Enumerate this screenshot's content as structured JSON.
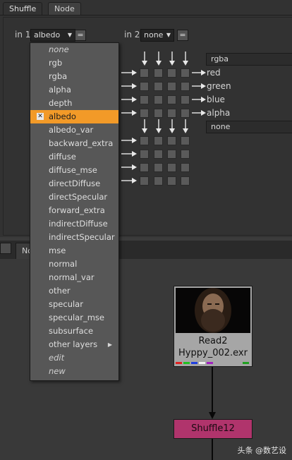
{
  "tabs": {
    "shuffle": "Shuffle",
    "node": "Node"
  },
  "in1": {
    "label": "in 1",
    "value": "albedo",
    "eq": "="
  },
  "in2": {
    "label": "in 2",
    "value": "none",
    "eq": "="
  },
  "right_group1": {
    "layer": "rgba",
    "outputs": [
      "red",
      "green",
      "blue",
      "alpha"
    ]
  },
  "right_group2": {
    "layer": "none"
  },
  "menu": {
    "items": [
      {
        "label": "none",
        "italic": true
      },
      {
        "label": "rgb"
      },
      {
        "label": "rgba"
      },
      {
        "label": "alpha"
      },
      {
        "label": "depth"
      },
      {
        "label": "albedo",
        "selected": true
      },
      {
        "label": "albedo_var"
      },
      {
        "label": "backward_extra"
      },
      {
        "label": "diffuse"
      },
      {
        "label": "diffuse_mse"
      },
      {
        "label": "directDiffuse"
      },
      {
        "label": "directSpecular"
      },
      {
        "label": "forward_extra"
      },
      {
        "label": "indirectDiffuse"
      },
      {
        "label": "indirectSpecular"
      },
      {
        "label": "mse"
      },
      {
        "label": "normal"
      },
      {
        "label": "normal_var"
      },
      {
        "label": "other"
      },
      {
        "label": "specular"
      },
      {
        "label": "specular_mse"
      },
      {
        "label": "subsurface"
      },
      {
        "label": "other layers",
        "submenu": true
      },
      {
        "label": "edit",
        "italic": true
      },
      {
        "label": "new",
        "italic": true
      }
    ]
  },
  "graph": {
    "tab_label": "No",
    "read_node": {
      "name": "Read2",
      "file": "Hyppy_002.exr"
    },
    "shuffle_node": {
      "name": "Shuffle12"
    },
    "channel_colors": [
      "#e02020",
      "#20c020",
      "#2040e0",
      "#f0f0f0",
      "#a020c0",
      "#20a020"
    ]
  },
  "watermark": "头条 @数艺设",
  "colors": {
    "accent": "#f29a28",
    "shuffle_node": "#b0346c"
  }
}
